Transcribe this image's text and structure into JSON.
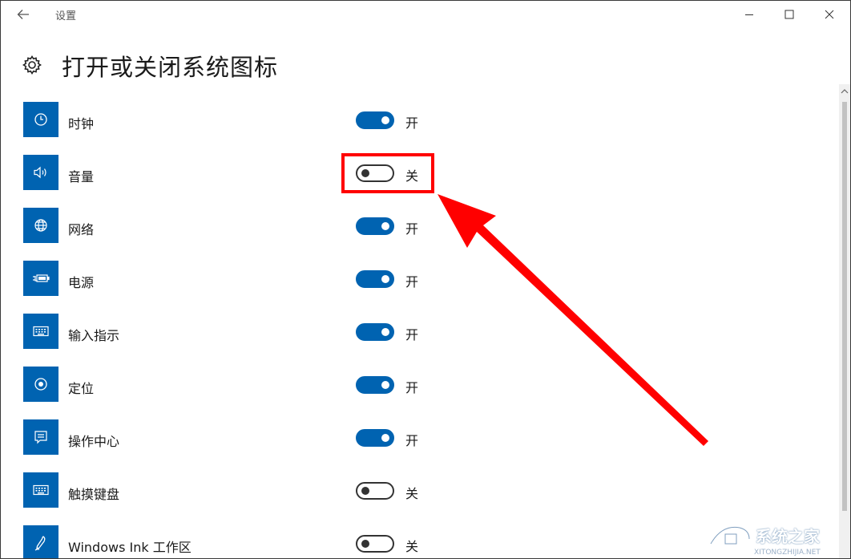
{
  "window": {
    "title": "设置",
    "buttons": {
      "back": "back-arrow-icon",
      "minimize": "minimize-icon",
      "maximize": "maximize-icon",
      "close": "close-icon"
    }
  },
  "page": {
    "title": "打开或关闭系统图标",
    "icon": "gear-icon"
  },
  "items": [
    {
      "label": "时钟",
      "icon": "clock-icon",
      "on": true,
      "state": "开"
    },
    {
      "label": "音量",
      "icon": "volume-icon",
      "on": false,
      "state": "关"
    },
    {
      "label": "网络",
      "icon": "globe-icon",
      "on": true,
      "state": "开"
    },
    {
      "label": "电源",
      "icon": "battery-plug-icon",
      "on": true,
      "state": "开"
    },
    {
      "label": "输入指示",
      "icon": "keyboard-icon",
      "on": true,
      "state": "开"
    },
    {
      "label": "定位",
      "icon": "location-target-icon",
      "on": true,
      "state": "开"
    },
    {
      "label": "操作中心",
      "icon": "action-center-icon",
      "on": true,
      "state": "开"
    },
    {
      "label": "触摸键盘",
      "icon": "keyboard-icon",
      "on": false,
      "state": "关"
    },
    {
      "label": "Windows Ink 工作区",
      "icon": "pen-icon",
      "on": false,
      "state": "关"
    }
  ],
  "colors": {
    "accent": "#0063b1",
    "annotation": "#ff0000"
  },
  "watermark": {
    "text": "系统之家",
    "sub": "XITONGZHIJIA.NET"
  }
}
